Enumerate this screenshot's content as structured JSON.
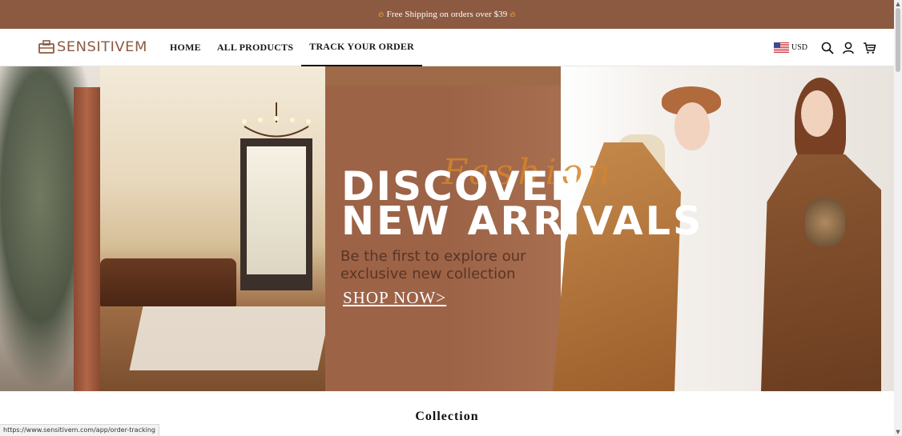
{
  "announcement": {
    "text": "Free Shipping on orders over $39",
    "icon_left": "flame-icon",
    "icon_right": "flame-icon"
  },
  "header": {
    "logo_text": "SENSITIVEM",
    "nav": [
      {
        "label": "HOME"
      },
      {
        "label": "ALL PRODUCTS"
      },
      {
        "label": "TRACK YOUR ORDER",
        "active": true
      }
    ],
    "currency": "USD",
    "icons": [
      "us-flag-icon",
      "search-icon",
      "account-icon",
      "cart-icon"
    ]
  },
  "hero": {
    "script_word": "Fashion",
    "headline_line1": "DISCOVER",
    "headline_line2": "NEW ARRIVALS",
    "subheadline": "Be the first to explore our exclusive new collection",
    "cta": "SHOP NOW>"
  },
  "sections": {
    "collection_title": "Collection"
  },
  "status_bar": {
    "url": "https://www.sensitivem.com/app/order-tracking"
  },
  "colors": {
    "brand": "#8c5a40",
    "hero_panel": "#9d6347",
    "script_accent": "#d4842c"
  }
}
